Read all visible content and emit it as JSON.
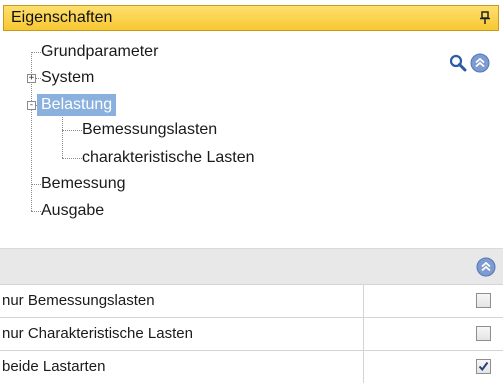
{
  "panel": {
    "title": "Eigenschaften",
    "pin_icon": "pin-icon",
    "accent": "#f8c832"
  },
  "tree": {
    "items": [
      {
        "label": "Grundparameter"
      },
      {
        "label": "System",
        "expander": "+"
      },
      {
        "label": "Belastung",
        "expander": "-",
        "selected": true
      },
      {
        "label": "Bemessungslasten"
      },
      {
        "label": "charakteristische Lasten"
      },
      {
        "label": "Bemessung"
      },
      {
        "label": "Ausgabe"
      }
    ],
    "search_icon": "search-icon",
    "collapse_icon": "double-chevron-up-icon",
    "selected_color": "#8ab0de"
  },
  "properties": {
    "collapse_icon": "double-chevron-up-icon",
    "rows": [
      {
        "label": "nur Bemessungslasten",
        "checked": false
      },
      {
        "label": "nur Charakteristische Lasten",
        "checked": false
      },
      {
        "label": "beide Lastarten",
        "checked": true
      }
    ]
  }
}
